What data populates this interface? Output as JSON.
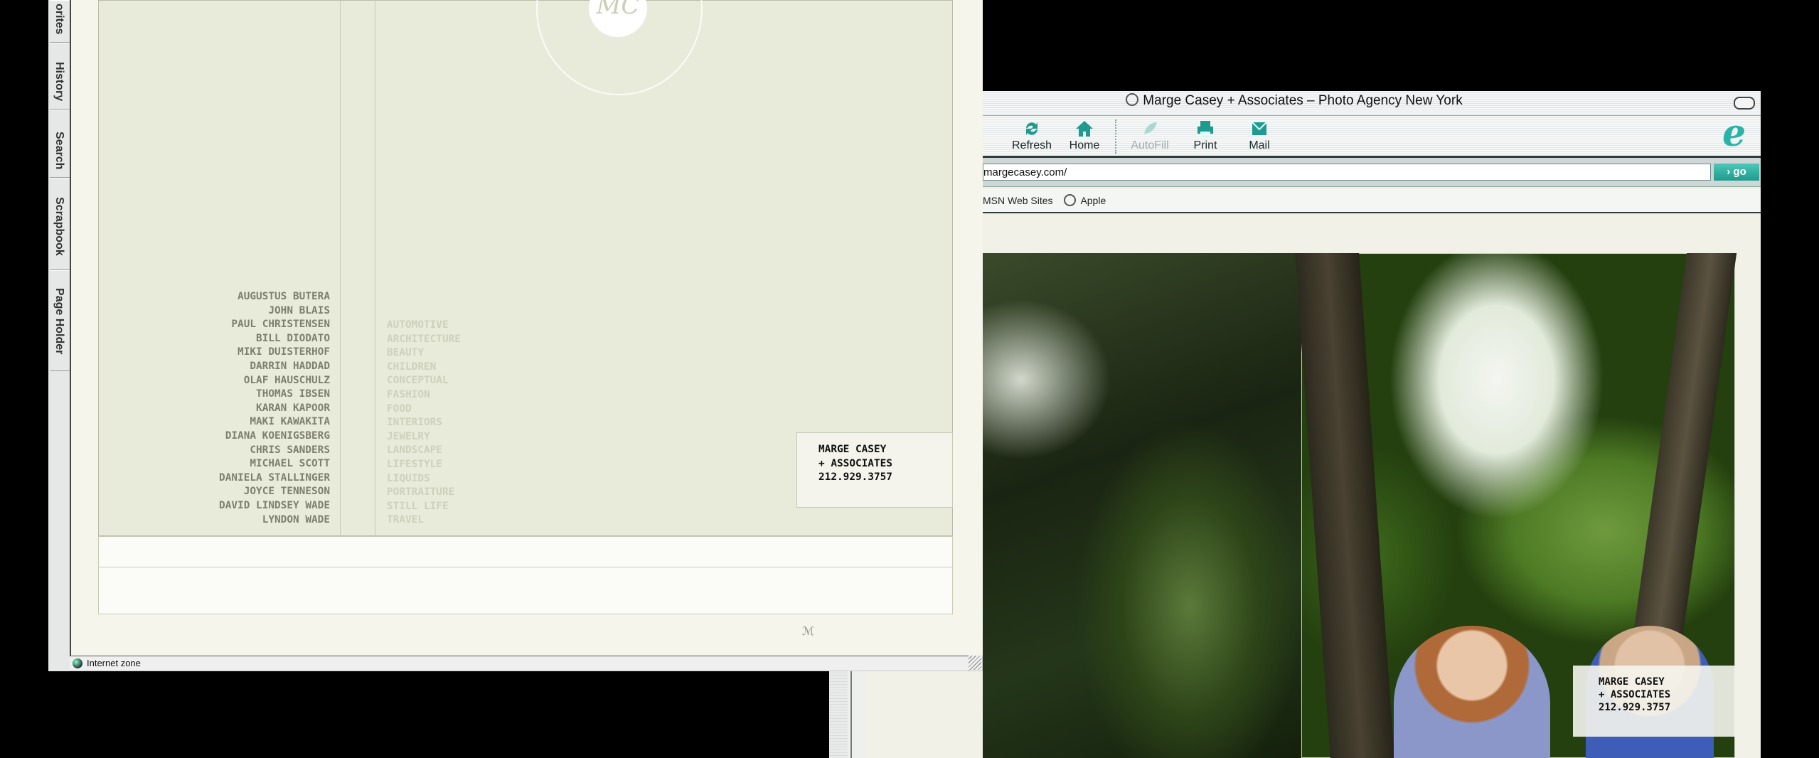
{
  "back_window": {
    "title": "Marge Casey + Associates – Photo Agency New York",
    "toolbar": {
      "refresh_label": "Refresh",
      "home_label": "Home",
      "autofill_label": "AutoFill",
      "print_label": "Print",
      "mail_label": "Mail"
    },
    "address": "margecasey.com/",
    "go_label": "› go",
    "favorites": [
      "MSN Web Sites",
      "Apple"
    ],
    "card": [
      "MARGE CASEY",
      "+ ASSOCIATES",
      "212.929.3757"
    ]
  },
  "front_window": {
    "explorer_tabs": [
      "orites",
      "History",
      "Search",
      "Scrapbook",
      "Page Holder"
    ],
    "logo_monogram": "MC",
    "photographers": [
      "AUGUSTUS BUTERA",
      "JOHN BLAIS",
      "PAUL CHRISTENSEN",
      "BILL DIODATO",
      "MIKI DUISTERHOF",
      "DARRIN HADDAD",
      "OLAF HAUSCHULZ",
      "THOMAS IBSEN",
      "KARAN KAPOOR",
      "MAKI KAWAKITA",
      "DIANA KOENIGSBERG",
      "CHRIS SANDERS",
      "MICHAEL SCOTT",
      "DANIELA STALLINGER",
      "JOYCE TENNESON",
      "DAVID LINDSEY WADE",
      "LYNDON WADE"
    ],
    "categories": [
      "AUTOMOTIVE",
      "ARCHITECTURE",
      "BEAUTY",
      "CHILDREN",
      "CONCEPTUAL",
      "FASHION",
      "FOOD",
      "INTERIORS",
      "JEWELRY",
      "LANDSCAPE",
      "LIFESTYLE",
      "LIQUIDS",
      "PORTRAITURE",
      "STILL LIFE",
      "TRAVEL"
    ],
    "card": [
      "MARGE CASEY",
      "+ ASSOCIATES",
      "212.929.3757"
    ],
    "status_text": "Internet zone"
  },
  "colors": {
    "accent": "#2bb3a8",
    "panel_bg": "#e8ebda",
    "names_text": "#7e7f6e",
    "categories_text": "#cdd0bc"
  },
  "icons": {
    "refresh": "refresh-icon",
    "home": "home-icon",
    "autofill": "autofill-icon",
    "print": "print-icon",
    "mail": "mail-icon",
    "ie": "ie-logo-icon",
    "globe": "globe-icon"
  }
}
